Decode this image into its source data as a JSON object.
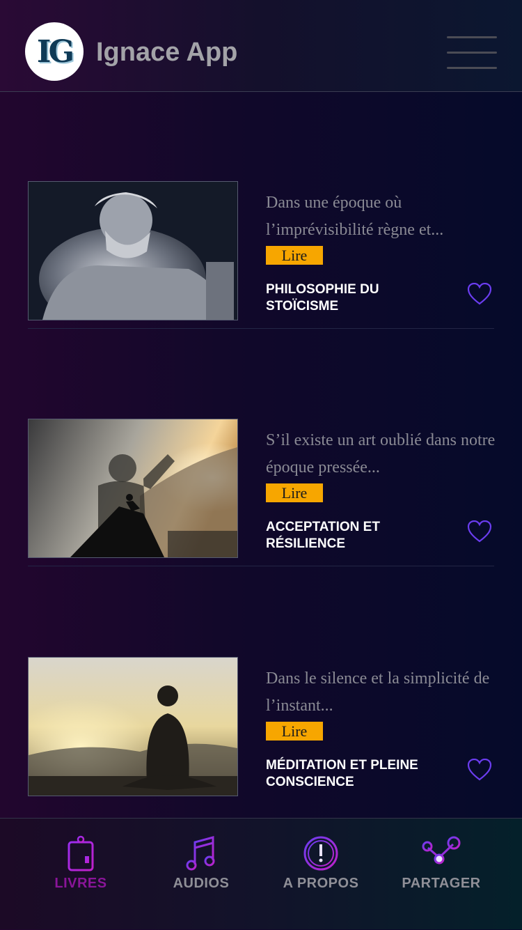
{
  "header": {
    "logo_text": "IG",
    "title": "Ignace App",
    "menu_icon": "hamburger-menu-icon"
  },
  "books": [
    {
      "excerpt": "Dans une époque où l’imprévisibilité règne et...",
      "read_label": "Lire",
      "title": "PHILOSOPHIE DU STOÏCISME",
      "favorite_icon": "heart-icon"
    },
    {
      "excerpt": "S’il existe un art oublié dans notre époque pressée...",
      "read_label": "Lire",
      "title": "ACCEPTATION ET RÉSILIENCE",
      "favorite_icon": "heart-icon"
    },
    {
      "excerpt": "Dans le silence et la simplicité de l’instant...",
      "read_label": "Lire",
      "title": "MÉDITATION ET PLEINE CONSCIENCE",
      "favorite_icon": "heart-icon"
    }
  ],
  "tabs": [
    {
      "label": "LIVRES",
      "icon": "book-icon",
      "active": true
    },
    {
      "label": "AUDIOS",
      "icon": "music-note-icon",
      "active": false
    },
    {
      "label": "A PROPOS",
      "icon": "info-icon",
      "active": false
    },
    {
      "label": "PARTAGER",
      "icon": "share-icon",
      "active": false
    }
  ],
  "colors": {
    "accent": "#f7a600",
    "heart": "#6b3df0",
    "active_tab": "#8a1599",
    "inactive_tab": "#8f8f97"
  }
}
